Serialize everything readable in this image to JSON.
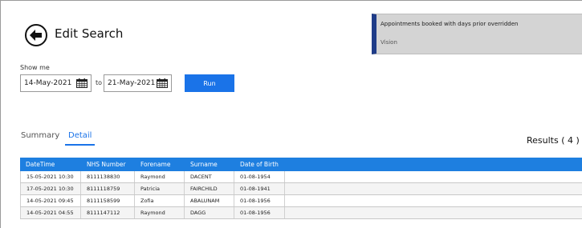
{
  "header": {
    "title": "Edit Search"
  },
  "info_card": {
    "title": "Appointments booked with days prior overridden",
    "subtitle": "Vision",
    "accent_color": "#1f3c88"
  },
  "filters": {
    "show_me_label": "Show me",
    "from_date": "14-May-2021",
    "to_label": "to",
    "to_date": "21-May-2021",
    "run_label": "Run"
  },
  "tabs": [
    {
      "label": "Summary",
      "active": false
    },
    {
      "label": "Detail",
      "active": true
    }
  ],
  "results_label": "Results ( 4 )",
  "table": {
    "columns": [
      "DateTime",
      "NHS Number",
      "Forename",
      "Surname",
      "Date of Birth"
    ],
    "rows": [
      [
        "15-05-2021 10:30",
        "8111138830",
        "Raymond",
        "DACENT",
        "01-08-1954"
      ],
      [
        "17-05-2021 10:30",
        "8111118759",
        "Patricia",
        "FAIRCHILD",
        "01-08-1941"
      ],
      [
        "14-05-2021 09:45",
        "8111158599",
        "Zofia",
        "ABALUNAM",
        "01-08-1956"
      ],
      [
        "14-05-2021 04:55",
        "8111147112",
        "Raymond",
        "DAGG",
        "01-08-1956"
      ]
    ]
  },
  "colors": {
    "accent": "#1a73e8",
    "table_header": "#1e7fe0"
  }
}
